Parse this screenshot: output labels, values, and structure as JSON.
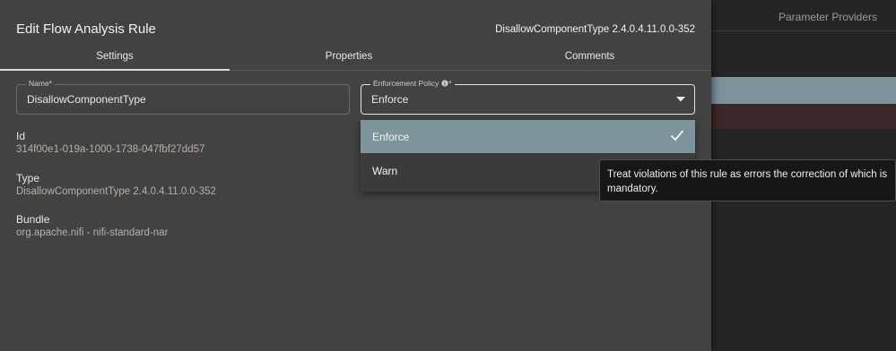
{
  "background": {
    "tab_label": "Parameter Providers"
  },
  "dialog": {
    "title": "Edit Flow Analysis Rule",
    "component_version": "DisallowComponentType 2.4.0.4.11.0.0-352",
    "tabs": [
      {
        "label": "Settings",
        "active": true
      },
      {
        "label": "Properties",
        "active": false
      },
      {
        "label": "Comments",
        "active": false
      }
    ],
    "name_field": {
      "label": "Name*",
      "value": "DisallowComponentType"
    },
    "policy_field": {
      "label": "Enforcement Policy",
      "required_mark": "*",
      "value": "Enforce"
    },
    "info": {
      "id_label": "Id",
      "id_value": "314f00e1-019a-1000-1738-047fbf27dd57",
      "type_label": "Type",
      "type_value": "DisallowComponentType 2.4.0.4.11.0.0-352",
      "bundle_label": "Bundle",
      "bundle_value": "org.apache.nifi - nifi-standard-nar"
    }
  },
  "dropdown": {
    "options": [
      {
        "label": "Enforce",
        "selected": true
      },
      {
        "label": "Warn",
        "selected": false
      }
    ]
  },
  "tooltip": {
    "text": "Treat violations of this rule as errors the correction of which is mandatory."
  },
  "colors": {
    "dialog_bg": "#424242",
    "selected_option": "#7e949c",
    "tooltip_bg": "#171717"
  }
}
